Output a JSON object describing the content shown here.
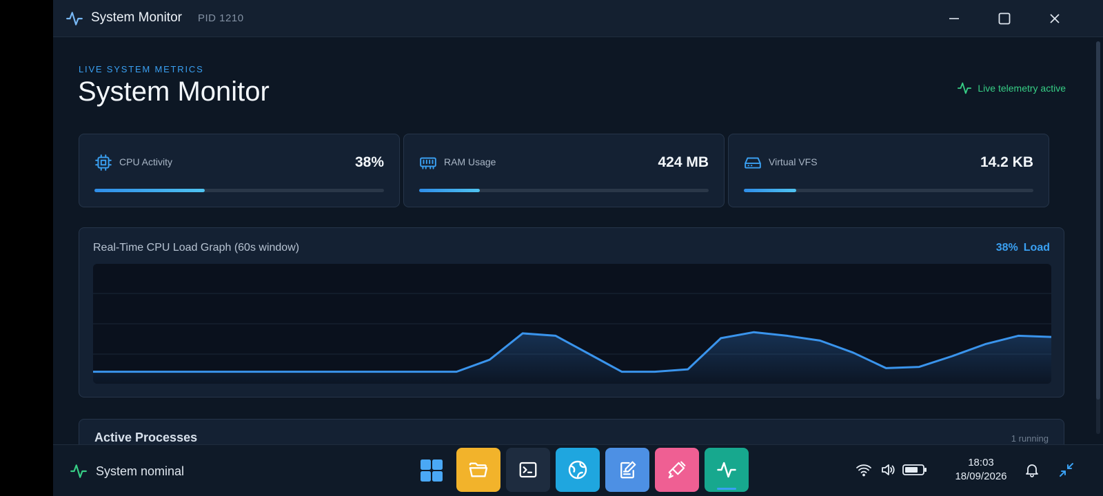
{
  "window": {
    "title": "System Monitor",
    "pid": "PID 1210"
  },
  "header": {
    "eyebrow": "LIVE SYSTEM METRICS",
    "title": "System Monitor",
    "live_status": "Live telemetry active"
  },
  "cards": [
    {
      "label": "CPU Activity",
      "value": "38%",
      "fill_percent": 38,
      "icon": "cpu-icon"
    },
    {
      "label": "RAM Usage",
      "value": "424 MB",
      "fill_percent": 21,
      "icon": "ram-icon"
    },
    {
      "label": "Virtual VFS",
      "value": "14.2 KB",
      "fill_percent": 18,
      "icon": "drive-icon"
    }
  ],
  "graph": {
    "title": "Real-Time CPU Load Graph (60s window)",
    "load_value": "38%",
    "load_label": "Load"
  },
  "chart_data": {
    "type": "area",
    "y": [
      10,
      10,
      10,
      10,
      10,
      10,
      10,
      10,
      10,
      10,
      10,
      10,
      20,
      42,
      40,
      25,
      10,
      10,
      12,
      38,
      43,
      40,
      36,
      26,
      13,
      14,
      23,
      33,
      40,
      39
    ],
    "ylim": [
      0,
      100
    ],
    "grid": true,
    "color": "#3a94ec"
  },
  "processes": {
    "title": "Active Processes",
    "count": "1 running"
  },
  "taskbar": {
    "status": "System nominal",
    "apps": [
      {
        "name": "files",
        "color": "#f2b32b"
      },
      {
        "name": "terminal",
        "color": "#1e2c3f"
      },
      {
        "name": "browser",
        "color": "#1fa6df"
      },
      {
        "name": "notes",
        "color": "#4d90e4"
      },
      {
        "name": "paint",
        "color": "#ef5f93"
      },
      {
        "name": "system-monitor",
        "color": "#17a88e"
      }
    ],
    "time": "18:03",
    "date": "18/09/2026"
  }
}
